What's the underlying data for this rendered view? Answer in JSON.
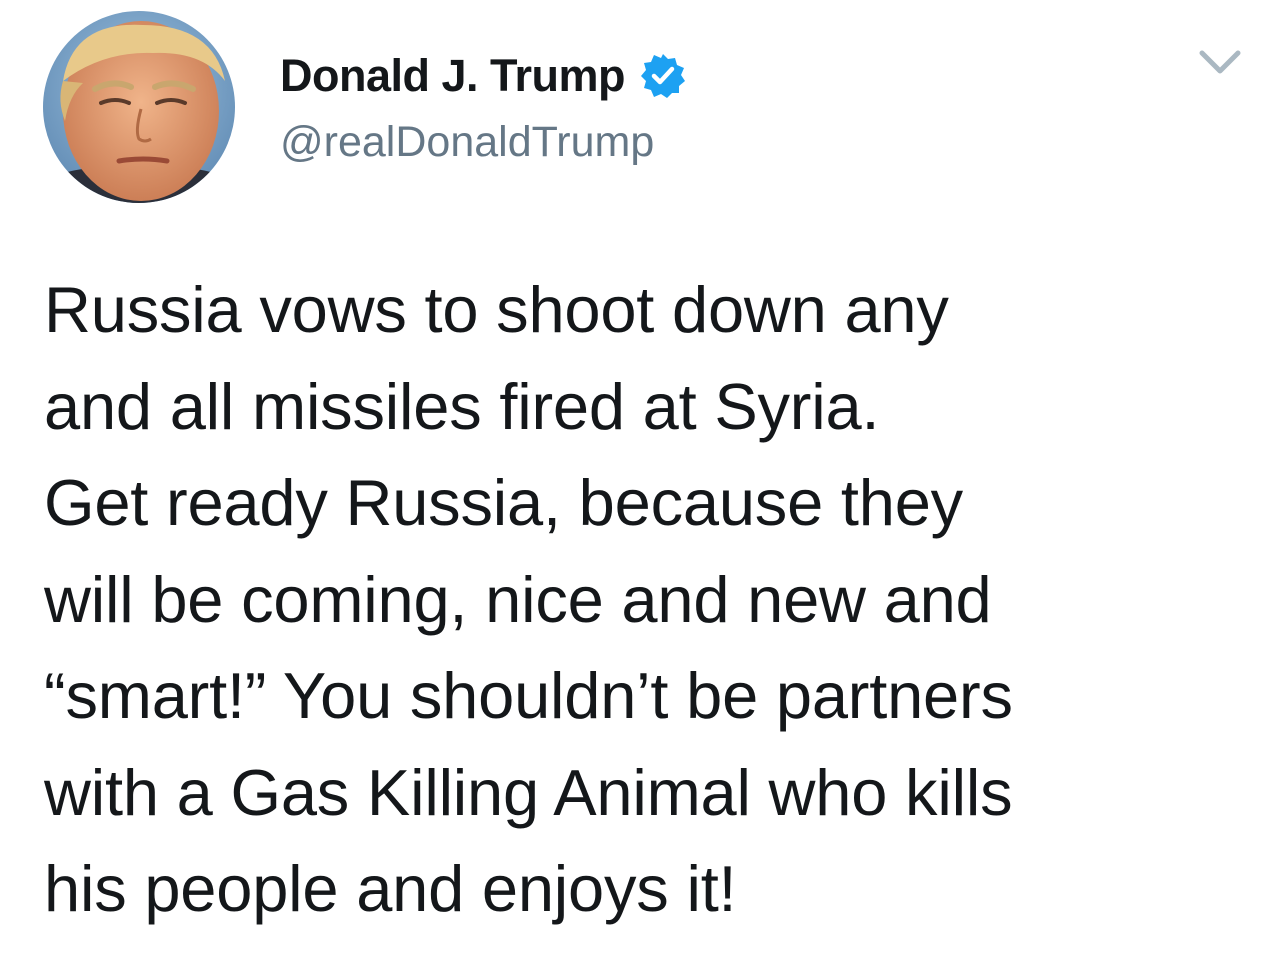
{
  "tweet": {
    "author": {
      "display_name": "Donald J. Trump",
      "handle": "@realDonaldTrump",
      "verified": true,
      "avatar_icon": "profile-photo"
    },
    "menu_icon": "chevron-down-icon",
    "text": "Russia vows to shoot down any\nand all missiles fired at Syria.\nGet ready Russia,  because they\nwill be coming, nice and new and\n“smart!” You shouldn’t be partners\nwith a Gas Killing Animal who kills\nhis people and enjoys it!"
  },
  "colors": {
    "text": "#14171a",
    "secondary": "#657786",
    "verified_blue": "#1da1f2",
    "caret": "#aab8c2"
  }
}
